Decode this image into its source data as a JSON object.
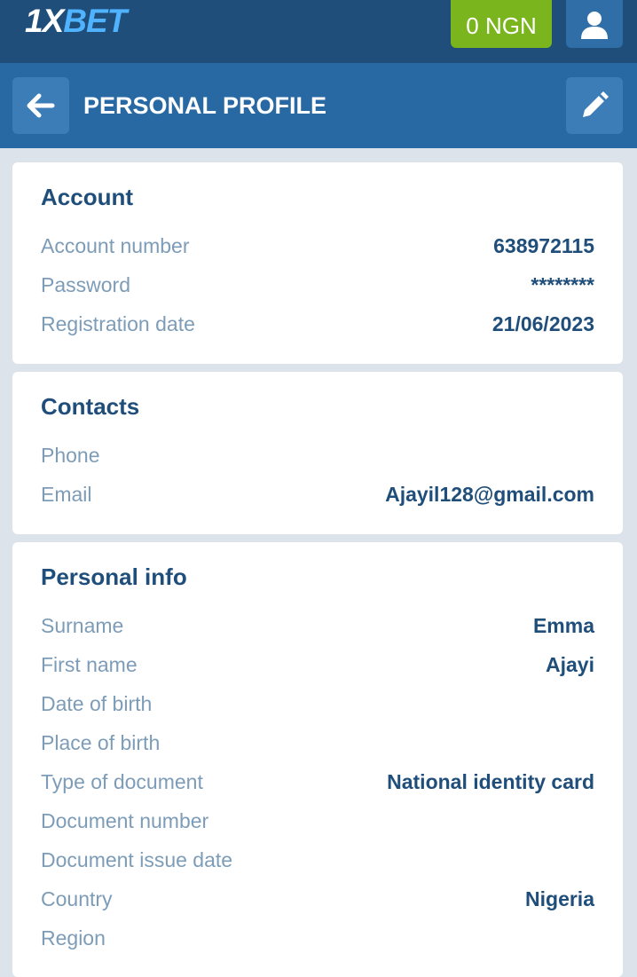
{
  "header": {
    "logo_prefix": "1X",
    "logo_suffix": "BET",
    "balance": "0 NGN",
    "user_icon": "user-icon"
  },
  "subheader": {
    "title": "PERSONAL PROFILE",
    "back_icon": "arrow-left-icon",
    "edit_icon": "pencil-icon"
  },
  "account": {
    "title": "Account",
    "rows": [
      {
        "label": "Account number",
        "value": "638972115"
      },
      {
        "label": "Password",
        "value": "********"
      },
      {
        "label": "Registration date",
        "value": "21/06/2023"
      }
    ]
  },
  "contacts": {
    "title": "Contacts",
    "rows": [
      {
        "label": "Phone",
        "value": ""
      },
      {
        "label": "Email",
        "value": "Ajayil128@gmail.com"
      }
    ]
  },
  "personal": {
    "title": "Personal info",
    "rows": [
      {
        "label": "Surname",
        "value": "Emma"
      },
      {
        "label": "First name",
        "value": "Ajayi"
      },
      {
        "label": "Date of birth",
        "value": ""
      },
      {
        "label": "Place of birth",
        "value": ""
      },
      {
        "label": "Type of document",
        "value": "National identity card"
      },
      {
        "label": "Document number",
        "value": ""
      },
      {
        "label": "Document issue date",
        "value": ""
      },
      {
        "label": "Country",
        "value": "Nigeria"
      },
      {
        "label": "Region",
        "value": ""
      }
    ]
  },
  "colors": {
    "topbar": "#1f4e7a",
    "subheader": "#2869a4",
    "balance_button": "#7ab51d",
    "label": "#7d9cb8",
    "value": "#1f4e7a"
  }
}
